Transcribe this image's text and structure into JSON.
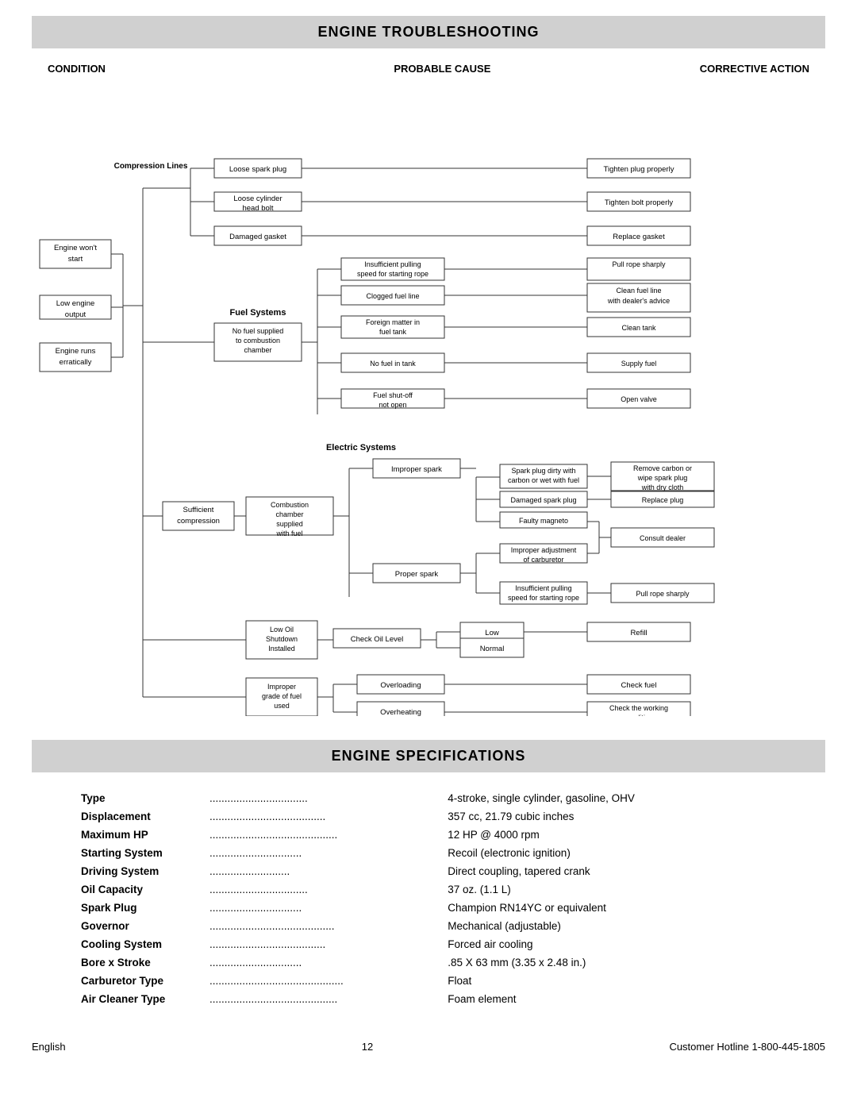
{
  "page": {
    "title1": "ENGINE TROUBLESHOOTING",
    "title2": "ENGINE SPECIFICATIONS",
    "footer_left": "English",
    "footer_page": "12",
    "footer_right": "Customer Hotline 1-800-445-1805"
  },
  "columns": {
    "condition": "CONDITION",
    "probable": "PROBABLE CAUSE",
    "corrective": "CORRECTIVE ACTION"
  },
  "specs": [
    {
      "label": "Type",
      "dots": ".................................",
      "value": "4-stroke, single cylinder, gasoline, OHV"
    },
    {
      "label": "Displacement",
      "dots": ".......................................",
      "value": "357 cc, 21.79 cubic inches"
    },
    {
      "label": "Maximum HP",
      "dots": "...........................................",
      "value": "12 HP @ 4000 rpm"
    },
    {
      "label": "Starting System",
      "dots": "...............................",
      "value": "Recoil (electronic ignition)"
    },
    {
      "label": "Driving System",
      "dots": "...........................",
      "value": "Direct coupling, tapered crank"
    },
    {
      "label": "Oil Capacity",
      "dots": ".................................",
      "value": "37 oz. (1.1 L)"
    },
    {
      "label": "Spark Plug",
      "dots": "...............................",
      "value": "Champion RN14YC or equivalent"
    },
    {
      "label": "Governor",
      "dots": "..........................................",
      "value": "Mechanical (adjustable)"
    },
    {
      "label": "Cooling System",
      "dots": ".......................................",
      "value": "Forced air cooling"
    },
    {
      "label": "Bore x Stroke",
      "dots": "...............................",
      "value": ".85 X 63 mm (3.35 x 2.48 in.)"
    },
    {
      "label": "Carburetor Type",
      "dots": ".............................................",
      "value": "Float"
    },
    {
      "label": "Air Cleaner Type",
      "dots": "...........................................",
      "value": "Foam element"
    }
  ]
}
